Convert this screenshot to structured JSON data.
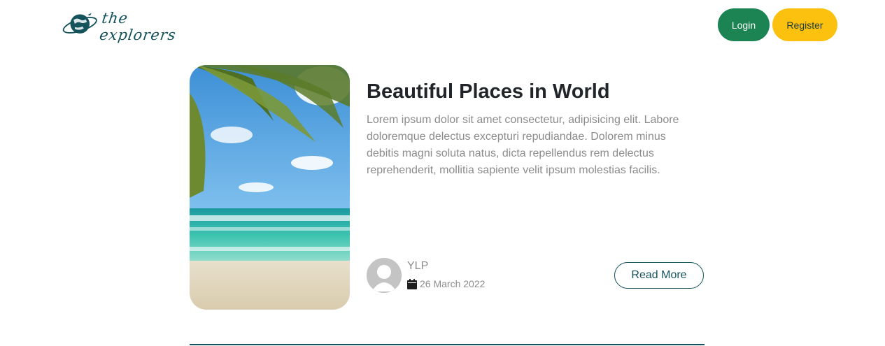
{
  "brand": {
    "logo_text": "the explorers",
    "logo_icon": "globe-plane-icon",
    "color": "#14525c"
  },
  "nav": {
    "login_label": "Login",
    "register_label": "Register",
    "login_color": "#1b8452",
    "register_color": "#fcc10f"
  },
  "post": {
    "image_icon": "beach-palm-image",
    "title": "Beautiful Places in World",
    "description": "Lorem ipsum dolor sit amet consectetur, adipisicing elit. Labore doloremque delectus excepturi repudiandae. Dolorem minus debitis magni soluta natus, dicta repellendus rem delectus reprehenderit, mollitia sapiente velit ipsum molestias facilis.",
    "author": "YLP",
    "date": "26 March 2022",
    "read_more_label": "Read More"
  }
}
